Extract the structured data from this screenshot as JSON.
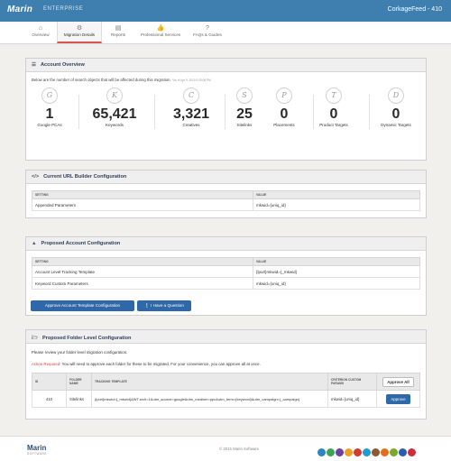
{
  "header": {
    "brand": "Marin",
    "product": "ENTERPRISE",
    "account": "CorkageFeed - 410"
  },
  "nav": [
    {
      "label": "Overview",
      "icon": "⌂"
    },
    {
      "label": "Migration Details",
      "icon": "⚙"
    },
    {
      "label": "Reports",
      "icon": "▤"
    },
    {
      "label": "Professional Services",
      "icon": "👍"
    },
    {
      "label": "FAQs & Guides",
      "icon": "?"
    }
  ],
  "overview": {
    "title": "Account Overview",
    "intro": "Below are the number of search objects that will be affected during this migration.",
    "asof": "*As of Apr 9, 2015 9:29:06 PM",
    "stats": [
      {
        "icon": "G",
        "value": "1",
        "label": "Google PCAs"
      },
      {
        "icon": "K",
        "value": "65,421",
        "label": "Keywords"
      },
      {
        "icon": "C",
        "value": "3,321",
        "label": "Creatives"
      },
      {
        "icon": "S",
        "value": "25",
        "label": "Sitelinks"
      },
      {
        "icon": "P",
        "value": "0",
        "label": "Placements"
      },
      {
        "icon": "T",
        "value": "0",
        "label": "Product Targets"
      },
      {
        "icon": "D",
        "value": "0",
        "label": "Dynamic Targets"
      }
    ]
  },
  "url_builder": {
    "title": "Current URL Builder Configuration",
    "col_setting": "SETTING",
    "col_value": "VALUE",
    "rows": [
      {
        "setting": "Appended Parameters",
        "value": "mkwid={uniq_id}"
      }
    ]
  },
  "proposed": {
    "title": "Proposed Account Configuration",
    "col_setting": "SETTING",
    "col_value": "VALUE",
    "rows": [
      {
        "setting": "Account Level Tracking Template",
        "value": "{lpurl}mkwid={_mkwid}"
      },
      {
        "setting": "Keyword Custom Parameters",
        "value": "mkwid={uniq_id}"
      }
    ],
    "approve_btn": "Approve Account Template Configuration",
    "question_btn": "I Have a Question"
  },
  "folder": {
    "title": "Proposed Folder Level Configuration",
    "review": "Please review your folder level migration configuration.",
    "action_label": "Action Required:",
    "action_text": " You will need to approve each folder for these to be migrated. For your convenience, you can approve all at once.",
    "cols": {
      "id": "ID",
      "name": "FOLDER NAME",
      "template": "TRACKING TEMPLATE",
      "criterion": "CRITERION CUSTOM PARAMS"
    },
    "approve_all": "Approve All",
    "rows": [
      {
        "id": "410",
        "name": "Sitelinks",
        "template": "{lpurl}mkwid={_mkwid}&WT.srch=1&utm_source=google&utm_medium=ppc&utm_term={keyword}&utm_campaign={_campaign}",
        "criterion": "mkwid={uniq_id}",
        "approve": "Approve"
      }
    ]
  },
  "footer": {
    "logo": "Marin",
    "logo_sub": "SOFTWARE",
    "copyright": "© 2015 Marin Software"
  },
  "partner_colors": [
    "#2e86c1",
    "#3aa655",
    "#6c3fa0",
    "#f0a020",
    "#d23c2c",
    "#1f9bd6",
    "#8c5a2c",
    "#e36f1e",
    "#7aa82a",
    "#2a5db0",
    "#cc2f3a"
  ]
}
